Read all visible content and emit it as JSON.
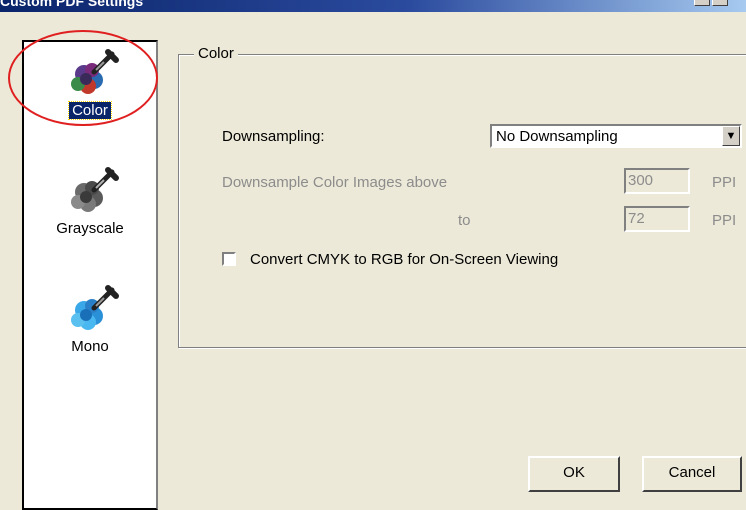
{
  "window": {
    "title": "Custom PDF Settings"
  },
  "sidebar": {
    "items": [
      {
        "label": "Color",
        "icon": "color-dropper-icon",
        "selected": true
      },
      {
        "label": "Grayscale",
        "icon": "grayscale-dropper-icon",
        "selected": false
      },
      {
        "label": "Mono",
        "icon": "mono-dropper-icon",
        "selected": false
      }
    ]
  },
  "panel": {
    "group_title": "Color",
    "downsampling_label": "Downsampling:",
    "downsampling_value": "No Downsampling",
    "above_label": "Downsample Color Images above",
    "above_value": "300",
    "above_unit": "PPI",
    "to_label": "to",
    "to_value": "72",
    "to_unit": "PPI",
    "convert_label": "Convert CMYK to RGB for On-Screen Viewing",
    "convert_checked": false
  },
  "buttons": {
    "ok_label": "OK",
    "cancel_label": "Cancel"
  },
  "colors": {
    "selection": "#0a246a",
    "annotation_ring": "#e02020",
    "dialog_bg": "#ece9d8"
  }
}
